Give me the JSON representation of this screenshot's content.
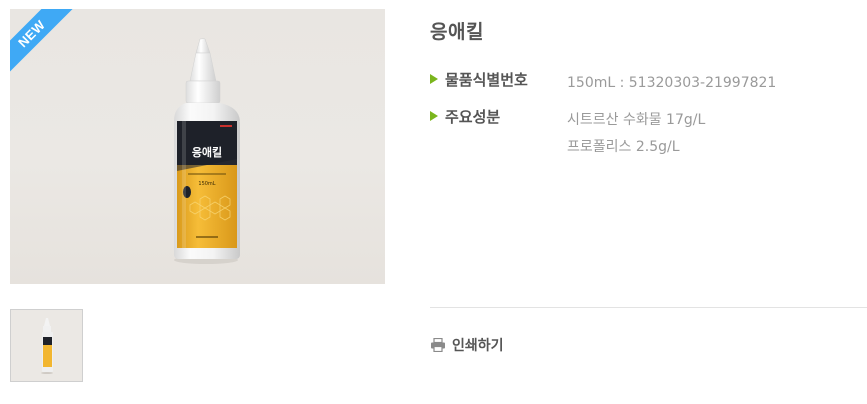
{
  "product": {
    "title": "응애킬",
    "badge": "NEW",
    "bottle_label_name": "응애킬",
    "bottle_label_volume": "150mL"
  },
  "specs": {
    "code_label": "물품식별번호",
    "code_value": "150mL : 51320303-21997821",
    "ingredients_label": "주요성분",
    "ingredients": [
      "시트르산 수화물 17g/L",
      "프로폴리스 2.5g/L"
    ]
  },
  "actions": {
    "print_label": "인쇄하기"
  },
  "icons": {
    "bullet": "triangle-right-icon",
    "print": "printer-icon"
  },
  "colors": {
    "accent_green": "#7ab51d",
    "new_badge_blue": "#3fa9f5",
    "bottle_label_yellow": "#f2b630",
    "bottle_label_dark": "#1e2129"
  }
}
